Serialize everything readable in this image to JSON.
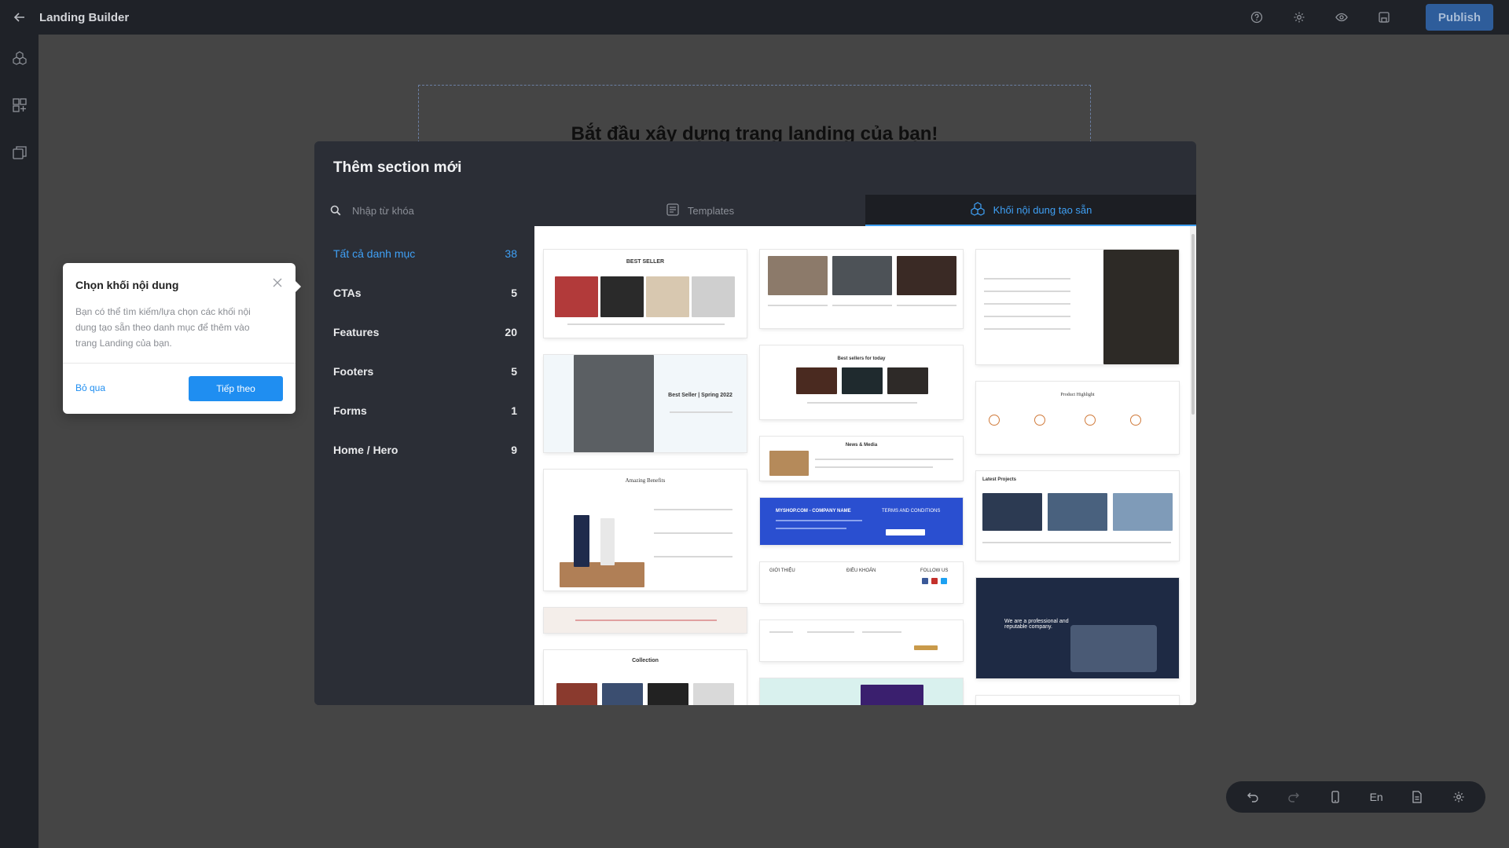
{
  "app": {
    "title": "Landing Builder",
    "publish_label": "Publish"
  },
  "top_icons": [
    "help-icon",
    "settings-icon",
    "preview-eye-icon",
    "save-icon"
  ],
  "rail_icons": [
    "blocks-icon",
    "sections-grid-icon",
    "pages-icon"
  ],
  "canvas": {
    "heading": "Bắt đầu xây dựng trang landing của bạn!"
  },
  "modal": {
    "title": "Thêm section mới",
    "search_placeholder": "Nhập từ khóa",
    "categories": [
      {
        "name": "Tất cả danh mục",
        "count": "38",
        "active": true
      },
      {
        "name": "CTAs",
        "count": "5"
      },
      {
        "name": "Features",
        "count": "20"
      },
      {
        "name": "Footers",
        "count": "5"
      },
      {
        "name": "Forms",
        "count": "1"
      },
      {
        "name": "Home / Hero",
        "count": "9"
      }
    ],
    "tabs": [
      {
        "label": "Templates",
        "active": false
      },
      {
        "label": "Khối nội dung tạo sẵn",
        "active": true
      }
    ],
    "previews": {
      "best_seller": "BEST SELLER",
      "best_seller_spring": "Best Seller | Spring 2022",
      "amazing_benefits": "Amazing Benefits",
      "collection": "Collection",
      "best_sellers_today": "Best sellers for today",
      "news_media": "News & Media",
      "company_name": "MYSHOP.COM - COMPANY NAME",
      "terms": "TERMS AND CONDITIONS",
      "footer_cols": [
        "GIỚI THIỆU",
        "ĐIỀU KHOẢN",
        "FOLLOW US"
      ],
      "product_highlight": "Product Highlight",
      "latest_projects": "Latest Projects",
      "professional": "We are a professional and reputable company."
    }
  },
  "tooltip": {
    "title": "Chọn khối nội dung",
    "body": "Bạn có thể tìm kiếm/lựa chọn các khối nội dung tạo sẵn theo danh mục để thêm vào trang Landing của bạn.",
    "skip_label": "Bỏ qua",
    "next_label": "Tiếp theo"
  },
  "bottom_toolbar": {
    "lang_label": "En"
  },
  "colors": {
    "accent": "#1f8ef1",
    "publish_bg": "#2e5d9b",
    "dark_bg": "#1f2228",
    "modal_bg": "#2b2e36"
  }
}
